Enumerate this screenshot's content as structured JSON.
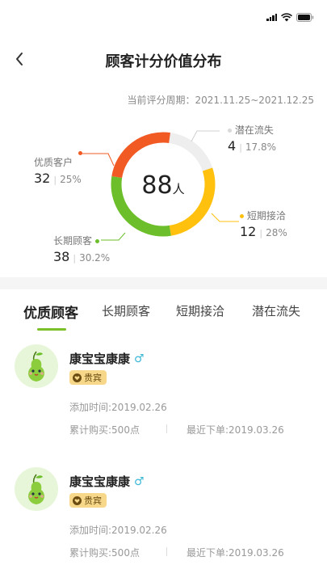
{
  "header": {
    "title": "顾客计分价值分布"
  },
  "period": {
    "label": "当前评分周期：",
    "range": "2021.11.25~2021.12.25"
  },
  "summary": {
    "total": "88",
    "unit": "人"
  },
  "segments": [
    {
      "name": "潜在流失",
      "count": "4",
      "percent": "17.8%",
      "color": "#eeeeee",
      "fraction": 0.178
    },
    {
      "name": "短期接洽",
      "count": "12",
      "percent": "28%",
      "color": "#ffc10e",
      "fraction": 0.28
    },
    {
      "name": "长期顾客",
      "count": "38",
      "percent": "30.2%",
      "color": "#6cbf2a",
      "fraction": 0.302
    },
    {
      "name": "优质客户",
      "count": "32",
      "percent": "25%",
      "color": "#f25a24",
      "fraction": 0.25
    }
  ],
  "tabs": [
    {
      "label": "优质顾客",
      "active": true
    },
    {
      "label": "长期顾客"
    },
    {
      "label": "短期接洽"
    },
    {
      "label": "潜在流失"
    }
  ],
  "customers": [
    {
      "name": "康宝宝康康",
      "badge": "贵宾",
      "added": "添加时间:2019.02.26",
      "purchase": "累计购买:500点",
      "last_order": "最近下单:2019.03.26"
    },
    {
      "name": "康宝宝康康",
      "badge": "贵宾",
      "added": "添加时间:2019.02.26",
      "purchase": "累计购买:500点",
      "last_order": "最近下单:2019.03.26"
    }
  ],
  "icons": {
    "back": "chevron-left-icon",
    "gender": "male-icon",
    "badge": "heart-badge-icon",
    "gender_symbol": "♂"
  },
  "colors": {
    "accent_green": "#7bbf2a",
    "male": "#3ab8d6"
  }
}
